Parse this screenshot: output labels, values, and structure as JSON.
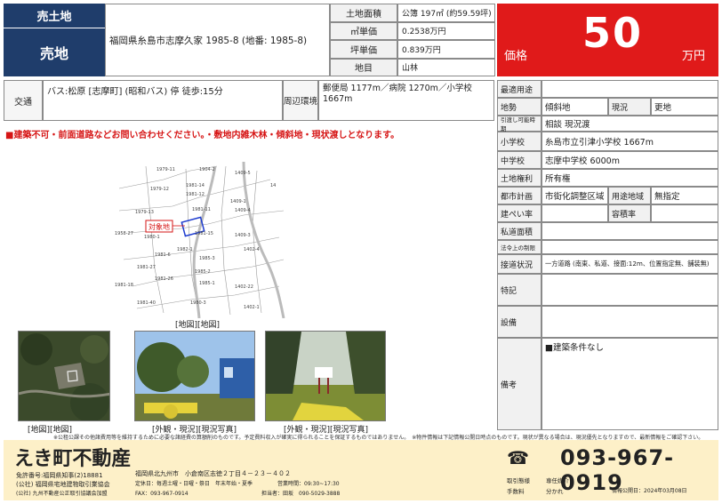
{
  "header": {
    "type_top": "売土地",
    "type_bottom": "売地",
    "address": "福岡県糸島市志摩久家 1985-8 (地番: 1985-8)"
  },
  "specs": [
    {
      "label": "土地面積",
      "value": "公簿 197㎡ (約59.59坪)"
    },
    {
      "label": "㎡単価",
      "value": "0.2538万円"
    },
    {
      "label": "坪単価",
      "value": "0.839万円"
    },
    {
      "label": "地目",
      "value": "山林"
    }
  ],
  "price": {
    "label": "価格",
    "amount": "50",
    "unit": "万円"
  },
  "traffic": {
    "label": "交通",
    "value": "バス:松原 [志摩町] (昭和バス) 停 徒歩:15分"
  },
  "environment": {
    "label": "周辺環境",
    "value": "郵便局 1177m／病院 1270m／小学校 1667m"
  },
  "warning": "■建築不可・前面道路などお問い合わせください。・敷地内雑木林・傾斜地・現状渡しとなります。",
  "details": {
    "applicable_law": {
      "label": "最適用途",
      "value": ""
    },
    "terrain": {
      "label": "地勢",
      "value": "傾斜地",
      "label2": "現況",
      "value2": "更地"
    },
    "delivery": {
      "label": "引渡し可能時期",
      "value": "相談 現況渡"
    },
    "elementary": {
      "label": "小学校",
      "value": "糸島市立引津小学校 1667m"
    },
    "junior_high": {
      "label": "中学校",
      "value": "志摩中学校 6000m"
    },
    "land_rights": {
      "label": "土地権利",
      "value": "所有権"
    },
    "city_planning": {
      "label": "都市計画",
      "value": "市街化調整区域",
      "label2": "用途地域",
      "value2": "無指定"
    },
    "coverage": {
      "label": "建ぺい率",
      "value": "",
      "label2": "容積率",
      "value2": ""
    },
    "private_road": {
      "label": "私道面積",
      "value": ""
    },
    "legal_limits": {
      "label": "法令上の制限",
      "value": ""
    },
    "road_access": {
      "label": "接道状況",
      "value": "一方道路 (南東、私道、接面:12m、位置指定無、舗装無)"
    },
    "features": {
      "label": "特記",
      "value": ""
    },
    "facilities": {
      "label": "設備",
      "value": ""
    },
    "remarks": {
      "label": "備考",
      "value": "■建築条件なし"
    }
  },
  "map": {
    "target_label": "対象地",
    "caption": "[地図][地図]",
    "parcels": [
      "1979-11",
      "1904-2",
      "1409-5",
      "1979-12",
      "1981-14",
      "1981-12",
      "1409-1",
      "1409-4",
      "1979-13",
      "1981-11",
      "1958-27",
      "1980-1",
      "1409-3",
      "1981-15",
      "1981-6",
      "1982-1",
      "1985-3",
      "1402-4",
      "1981-27",
      "1985-2",
      "1981-18",
      "1981-26",
      "1985-1",
      "1402-22",
      "1981-40",
      "1980-3",
      "1402-1",
      "14"
    ]
  },
  "photos": [
    {
      "caption": "[地図][地図]"
    },
    {
      "caption": "[外観・現況][現況写真]"
    },
    {
      "caption": "[外観・現況][現況写真]"
    }
  ],
  "disclaimer": "※公租公課その他諸費用等を維持するために必要な諸経費の算額削のものです。予定費料収入が確実に得られることを保証するものではありません。　※物件情報は下記情報公開日時点のものです。現状が異なる場合は、現況優先となりますので、最新情報をご確認下さい。",
  "footer": {
    "company": "えき町不動産",
    "license": "免許番号:福岡県知事(2)18881",
    "association1": "(公社) 福岡県宅地建物取引業協会",
    "association2": "(公社) 九州不動産公正取引協議会加盟",
    "address": "福岡県北九州市　小倉南区志徳２丁目４－２３－４０２",
    "holidays": "定休日：毎週土曜・日曜・祭日　年末年始・夏季",
    "hours": "営業時間：09:30~17:30",
    "fax": "FAX：093-967-0914",
    "staff": "担当者：田坂　090-5029-3888",
    "phone": "093-967-0919",
    "transaction_label": "取引態様",
    "transaction_value": "専任媒介",
    "fee_label": "手数料",
    "fee_value": "分かれ",
    "published": "情報公開日：2024年03月08日"
  }
}
